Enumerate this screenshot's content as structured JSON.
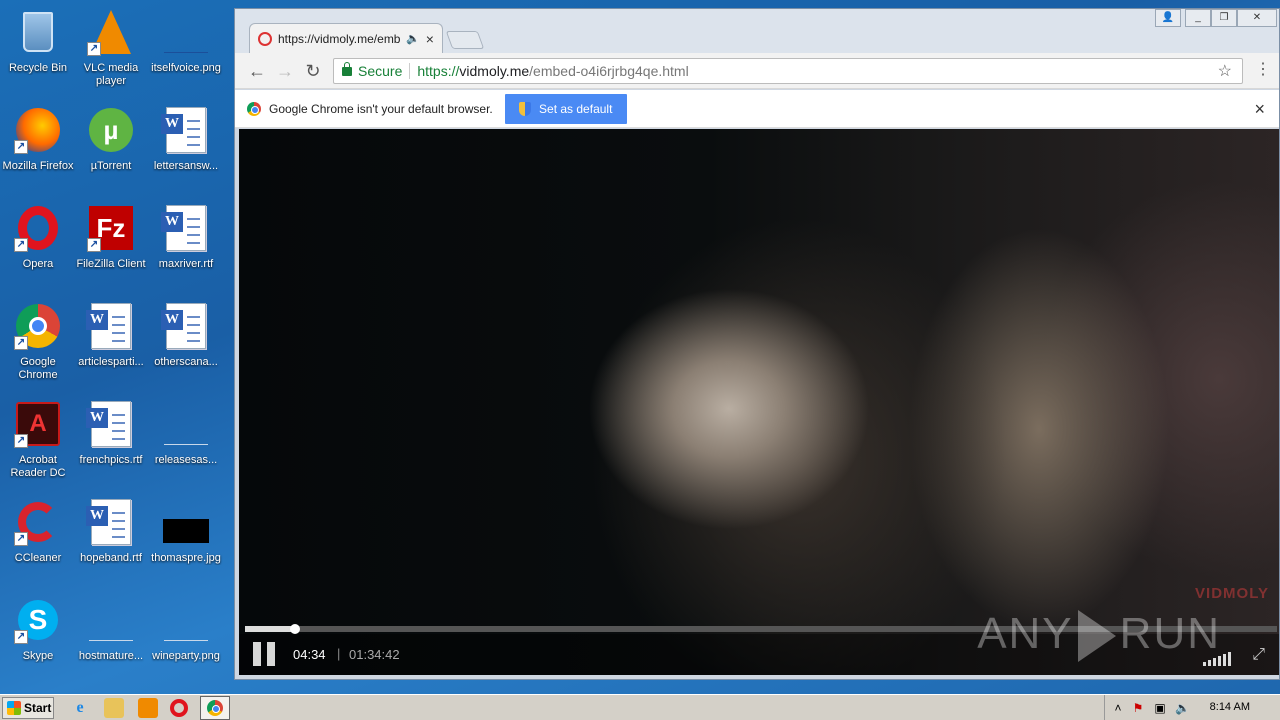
{
  "desktop": {
    "icons": [
      {
        "label": "Recycle Bin"
      },
      {
        "label": "VLC media player"
      },
      {
        "label": "itselfvoice.png"
      },
      {
        "label": "Mozilla Firefox"
      },
      {
        "label": "µTorrent"
      },
      {
        "label": "lettersansw..."
      },
      {
        "label": "Opera"
      },
      {
        "label": "FileZilla Client"
      },
      {
        "label": "maxriver.rtf"
      },
      {
        "label": "Google Chrome"
      },
      {
        "label": "articlesparti..."
      },
      {
        "label": "otherscana..."
      },
      {
        "label": "Acrobat Reader DC"
      },
      {
        "label": "frenchpics.rtf"
      },
      {
        "label": "releasesas..."
      },
      {
        "label": "CCleaner"
      },
      {
        "label": "hopeband.rtf"
      },
      {
        "label": "thomaspre.jpg"
      },
      {
        "label": "Skype"
      },
      {
        "label": "hostmature..."
      },
      {
        "label": "wineparty.png"
      }
    ]
  },
  "browser": {
    "tab": {
      "title": "https://vidmoly.me/emb",
      "audio_icon": "speaker-icon",
      "close": "×"
    },
    "address": {
      "secure_label": "Secure",
      "scheme": "https://",
      "host": "vidmoly.me",
      "path": "/embed-o4i6rjrbg4qe.html"
    },
    "infobar": {
      "message": "Google Chrome isn't your default browser.",
      "button_label": "Set as default",
      "close": "×"
    },
    "colors": {
      "secure": "#188038",
      "button": "#4a8af4"
    }
  },
  "player": {
    "watermark": "VIDMOLY",
    "current_time": "04:34",
    "divider": "|",
    "total_time": "01:34:42",
    "progress": 0.048
  },
  "overlay": {
    "left": "ANY",
    "right": "RUN"
  },
  "taskbar": {
    "start_label": "Start",
    "clock": "8:14 AM"
  }
}
